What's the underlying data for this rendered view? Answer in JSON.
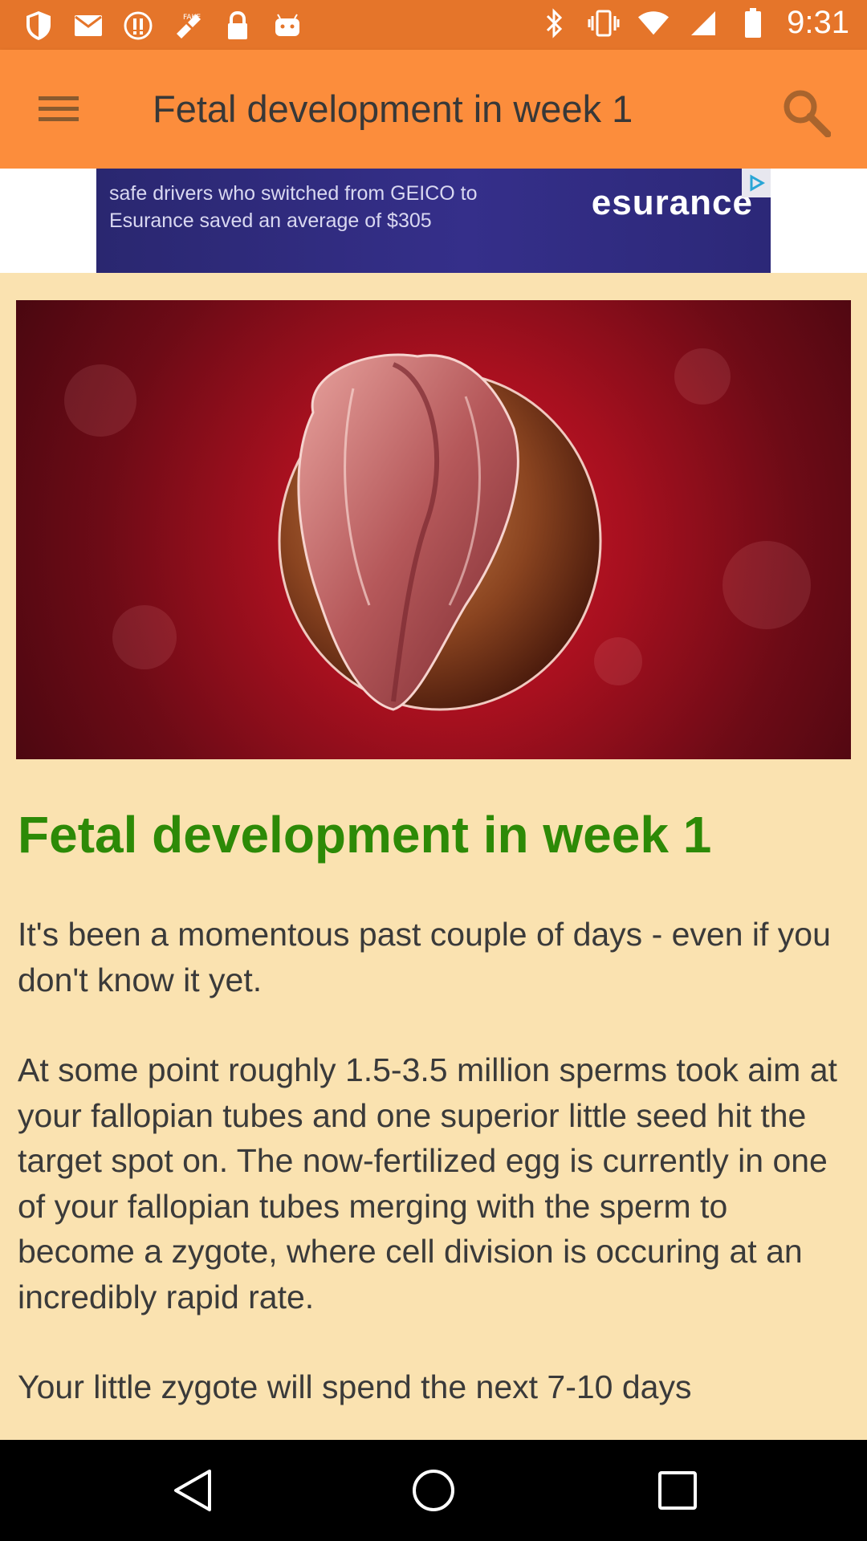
{
  "status_bar": {
    "time": "9:31",
    "left_icons": [
      "shield-icon",
      "mail-icon",
      "alert-icon",
      "fake-gps-icon",
      "lock-icon",
      "android-icon"
    ],
    "right_icons": [
      "bluetooth-icon",
      "vibrate-icon",
      "wifi-icon",
      "signal-icon",
      "battery-icon"
    ]
  },
  "app_bar": {
    "title": "Fetal development in week 1",
    "menu_icon": "menu-icon",
    "search_icon": "search-icon"
  },
  "ad": {
    "text": "safe drivers who switched from GEICO to Esurance saved an average of $305",
    "brand": "esurance"
  },
  "article": {
    "image": "embryo-illustration",
    "title": "Fetal development in week 1",
    "paragraphs": [
      "It's been a momentous past couple of days - even if you don't know it yet.",
      "At some point roughly 1.5-3.5 million sperms took aim at your fallopian tubes and one superior little seed hit the target spot on. The now-fertilized egg is currently in one of your fallopian tubes merging with the sperm to become a zygote, where cell division is occuring at an incredibly rapid rate.",
      "Your little zygote will spend the next 7-10 days"
    ]
  },
  "colors": {
    "status_bar": "#e5752a",
    "app_bar": "#fc8d3c",
    "background": "#fae2b0",
    "title_green": "#2d8a07"
  },
  "nav_bar": {
    "buttons": [
      "back-icon",
      "home-icon",
      "recents-icon"
    ]
  }
}
